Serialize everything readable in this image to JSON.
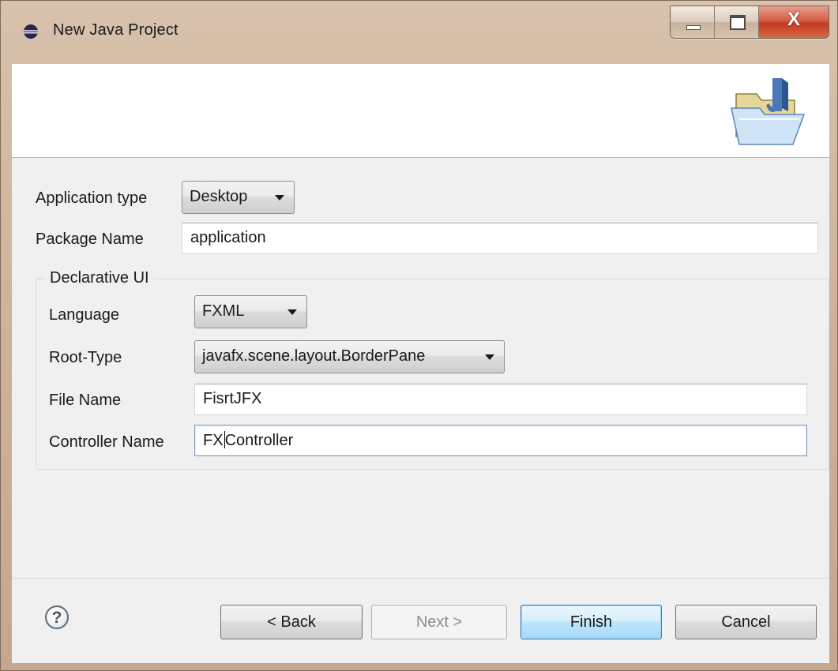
{
  "window": {
    "title": "New Java Project",
    "controls": {
      "minimize": "minimize",
      "maximize": "maximize",
      "close": "X"
    }
  },
  "form": {
    "application_type": {
      "label": "Application type",
      "value": "Desktop"
    },
    "package_name": {
      "label": "Package Name",
      "value": "application"
    },
    "declarative_ui": {
      "group_title": "Declarative UI",
      "language": {
        "label": "Language",
        "value": "FXML"
      },
      "root_type": {
        "label": "Root-Type",
        "value": "javafx.scene.layout.BorderPane"
      },
      "file_name": {
        "label": "File Name",
        "value": "FisrtJFX"
      },
      "controller_name": {
        "label": "Controller Name",
        "value_before_caret": "FX",
        "value_after_caret": "Controller"
      }
    }
  },
  "footer": {
    "help": "?",
    "back": "< Back",
    "next": "Next >",
    "finish": "Finish",
    "cancel": "Cancel"
  },
  "icons": {
    "title": "eclipse-icon",
    "wizard": "java-project-folder-icon",
    "help": "help-icon"
  }
}
